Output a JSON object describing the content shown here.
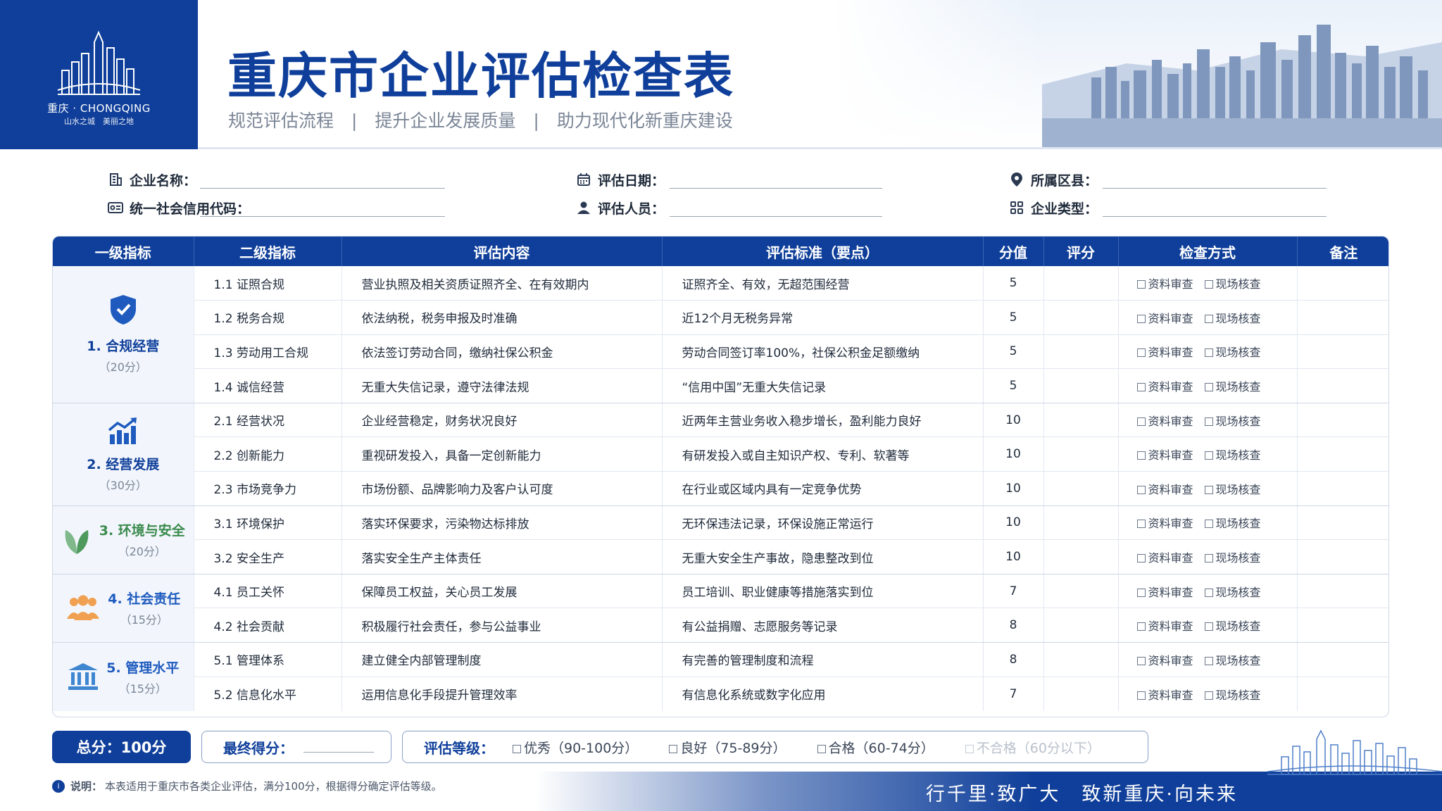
{
  "brand": {
    "name": "重庆 · CHONGQING",
    "slogan": "山水之城　美丽之地"
  },
  "header": {
    "title": "重庆市企业评估检查表",
    "subtitle": "规范评估流程　|　提升企业发展质量　|　助力现代化新重庆建设"
  },
  "info": {
    "company_name": "企业名称：",
    "credit_code": "统一社会信用代码：",
    "eval_date": "评估日期：",
    "evaluator": "评估人员：",
    "district": "所属区县：",
    "company_type": "企业类型："
  },
  "table": {
    "headers": [
      "一级指标",
      "二级指标",
      "评估内容",
      "评估标准（要点）",
      "分值",
      "评分",
      "检查方式",
      "备注"
    ],
    "methods": [
      "资料审查",
      "现场核查"
    ],
    "categories": [
      {
        "name": "1. 合规经营",
        "points": "（20分）",
        "icon": "shield-check-icon"
      },
      {
        "name": "2. 经营发展",
        "points": "（30分）",
        "icon": "growth-chart-icon"
      },
      {
        "name": "3. 环境与安全",
        "points": "（20分）",
        "icon": "leaf-icon"
      },
      {
        "name": "4. 社会责任",
        "points": "（15分）",
        "icon": "people-icon"
      },
      {
        "name": "5. 管理水平",
        "points": "（15分）",
        "icon": "institution-icon"
      }
    ],
    "rows": [
      {
        "sub": "1.1 证照合规",
        "content": "营业执照及相关资质证照齐全、在有效期内",
        "standard": "证照齐全、有效，无超范围经营",
        "score": "5"
      },
      {
        "sub": "1.2 税务合规",
        "content": "依法纳税，税务申报及时准确",
        "standard": "近12个月无税务异常",
        "score": "5"
      },
      {
        "sub": "1.3 劳动用工合规",
        "content": "依法签订劳动合同，缴纳社保公积金",
        "standard": "劳动合同签订率100%，社保公积金足额缴纳",
        "score": "5"
      },
      {
        "sub": "1.4 诚信经营",
        "content": "无重大失信记录，遵守法律法规",
        "standard": "“信用中国”无重大失信记录",
        "score": "5"
      },
      {
        "sub": "2.1 经营状况",
        "content": "企业经营稳定，财务状况良好",
        "standard": "近两年主营业务收入稳步增长，盈利能力良好",
        "score": "10"
      },
      {
        "sub": "2.2 创新能力",
        "content": "重视研发投入，具备一定创新能力",
        "standard": "有研发投入或自主知识产权、专利、软著等",
        "score": "10"
      },
      {
        "sub": "2.3 市场竞争力",
        "content": "市场份额、品牌影响力及客户认可度",
        "standard": "在行业或区域内具有一定竞争优势",
        "score": "10"
      },
      {
        "sub": "3.1 环境保护",
        "content": "落实环保要求，污染物达标排放",
        "standard": "无环保违法记录，环保设施正常运行",
        "score": "10"
      },
      {
        "sub": "3.2 安全生产",
        "content": "落实安全生产主体责任",
        "standard": "无重大安全生产事故，隐患整改到位",
        "score": "10"
      },
      {
        "sub": "4.1 员工关怀",
        "content": "保障员工权益，关心员工发展",
        "standard": "员工培训、职业健康等措施落实到位",
        "score": "7"
      },
      {
        "sub": "4.2 社会贡献",
        "content": "积极履行社会责任，参与公益事业",
        "standard": "有公益捐赠、志愿服务等记录",
        "score": "8"
      },
      {
        "sub": "5.1 管理体系",
        "content": "建立健全内部管理制度",
        "standard": "有完善的管理制度和流程",
        "score": "8"
      },
      {
        "sub": "5.2 信息化水平",
        "content": "运用信息化手段提升管理效率",
        "standard": "有信息化系统或数字化应用",
        "score": "7"
      }
    ]
  },
  "footer": {
    "total": "总分：100分",
    "final_score": "最终得分：",
    "grade_label": "评估等级：",
    "grades": [
      "优秀（90-100分）",
      "良好（75-89分）",
      "合格（60-74分）",
      "不合格（60分以下）"
    ],
    "note_label": "说明：",
    "note_text": "本表适用于重庆市各类企业评估，满分100分，根据得分确定评估等级。",
    "motto": "行千里·致广大　致新重庆·向未来"
  },
  "colors": {
    "primary": "#0f3f9a",
    "header_bg": "#0f3f9a",
    "accent_green": "#3a8a4c",
    "accent_orange": "#f0a050"
  }
}
